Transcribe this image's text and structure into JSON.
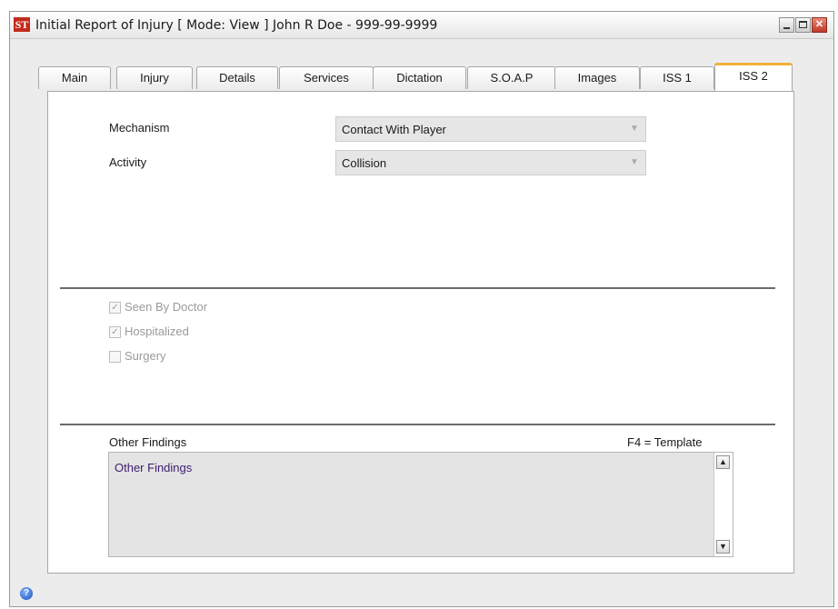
{
  "window": {
    "app_icon_text": "ST",
    "title": "Initial Report of Injury  [ Mode: View ]  John R Doe - 999-99-9999",
    "buttons": {
      "minimize": "",
      "maximize": "",
      "close": "✕"
    }
  },
  "tabs": [
    {
      "label": "Main"
    },
    {
      "label": "Injury"
    },
    {
      "label": "Details"
    },
    {
      "label": "Services"
    },
    {
      "label": "Dictation"
    },
    {
      "label": "S.O.A.P"
    },
    {
      "label": "Images"
    },
    {
      "label": "ISS 1"
    },
    {
      "label": "ISS 2",
      "active": true
    }
  ],
  "form": {
    "mechanism": {
      "label": "Mechanism",
      "value": "Contact With Player"
    },
    "activity": {
      "label": "Activity",
      "value": "Collision"
    }
  },
  "checkboxes": [
    {
      "label": "Seen By Doctor",
      "checked": true
    },
    {
      "label": "Hospitalized",
      "checked": true
    },
    {
      "label": "Surgery",
      "checked": false
    }
  ],
  "findings": {
    "label": "Other Findings",
    "hint": "F4 = Template",
    "value": "Other Findings"
  },
  "colors": {
    "active_tab_accent": "#f2b03a",
    "close_button": "#c0392b",
    "findings_text": "#3c1d6e"
  },
  "icons": {
    "help": "help-icon",
    "dropdown": "chevron-down-icon",
    "scroll_up": "arrow-up-icon",
    "scroll_down": "arrow-down-icon"
  }
}
